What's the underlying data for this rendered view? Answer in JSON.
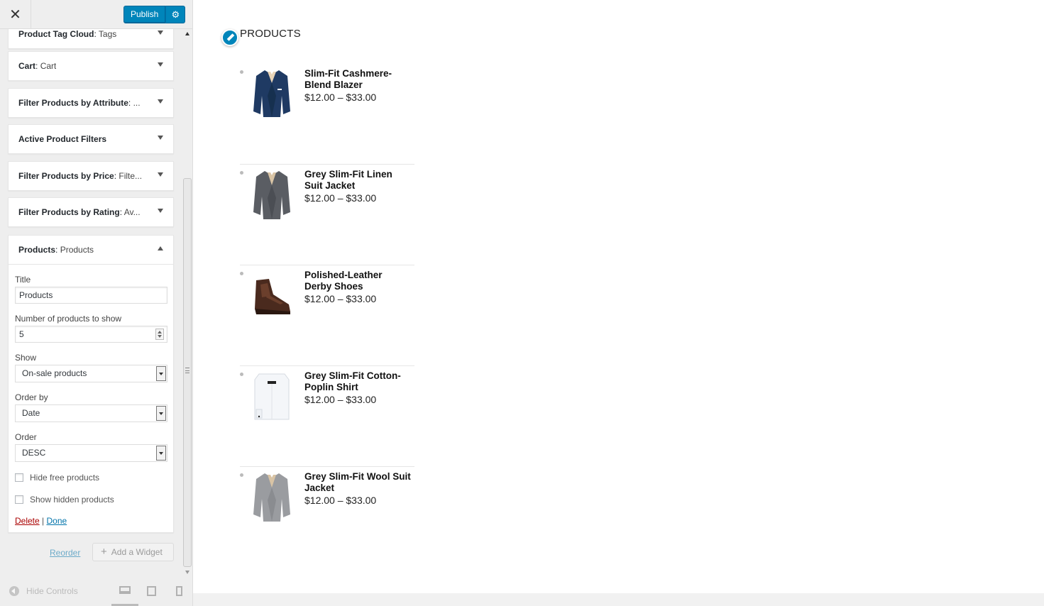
{
  "topbar": {
    "close_label": "✕",
    "publish_label": "Publish",
    "settings_symbol": "⚙"
  },
  "widgets": [
    {
      "title": "Product Tag Cloud",
      "subtitle": "Tags"
    },
    {
      "title": "Cart",
      "subtitle": "Cart"
    },
    {
      "title": "Filter Products by Attribute",
      "subtitle": "..."
    },
    {
      "title": "Active Product Filters",
      "subtitle": ""
    },
    {
      "title": "Filter Products by Price",
      "subtitle": "Filte..."
    },
    {
      "title": "Filter Products by Rating",
      "subtitle": "Av..."
    },
    {
      "title": "Products",
      "subtitle": "Products"
    }
  ],
  "products_form": {
    "title_label": "Title",
    "title_value": "Products",
    "number_label": "Number of products to show",
    "number_value": "5",
    "show_label": "Show",
    "show_value": "On-sale products",
    "orderby_label": "Order by",
    "orderby_value": "Date",
    "order_label": "Order",
    "order_value": "DESC",
    "hide_free_label": "Hide free products",
    "show_hidden_label": "Show hidden products",
    "delete_label": "Delete",
    "separator": "|",
    "done_label": "Done"
  },
  "sidebar_footer": {
    "reorder_label": "Reorder",
    "add_widget_label": "Add a Widget",
    "hide_controls_label": "Hide Controls"
  },
  "preview": {
    "heading": "PRODUCTS",
    "products": [
      {
        "name": "Slim-Fit Cashmere-Blend Blazer",
        "price": "$12.00 – $33.00",
        "image": "navy-blazer"
      },
      {
        "name": "Grey Slim-Fit Linen Suit Jacket",
        "price": "$12.00 – $33.00",
        "image": "grey-linen-jacket"
      },
      {
        "name": "Polished-Leather Derby Shoes",
        "price": "$12.00 – $33.00",
        "image": "brown-derby-shoes"
      },
      {
        "name": "Grey Slim-Fit Cotton-Poplin Shirt",
        "price": "$12.00 – $33.00",
        "image": "white-shirt"
      },
      {
        "name": "Grey Slim-Fit Wool Suit Jacket",
        "price": "$12.00 – $33.00",
        "image": "grey-wool-jacket"
      }
    ]
  },
  "colors": {
    "accent": "#0085ba",
    "delete": "#aa0000",
    "link": "#0073aa"
  }
}
